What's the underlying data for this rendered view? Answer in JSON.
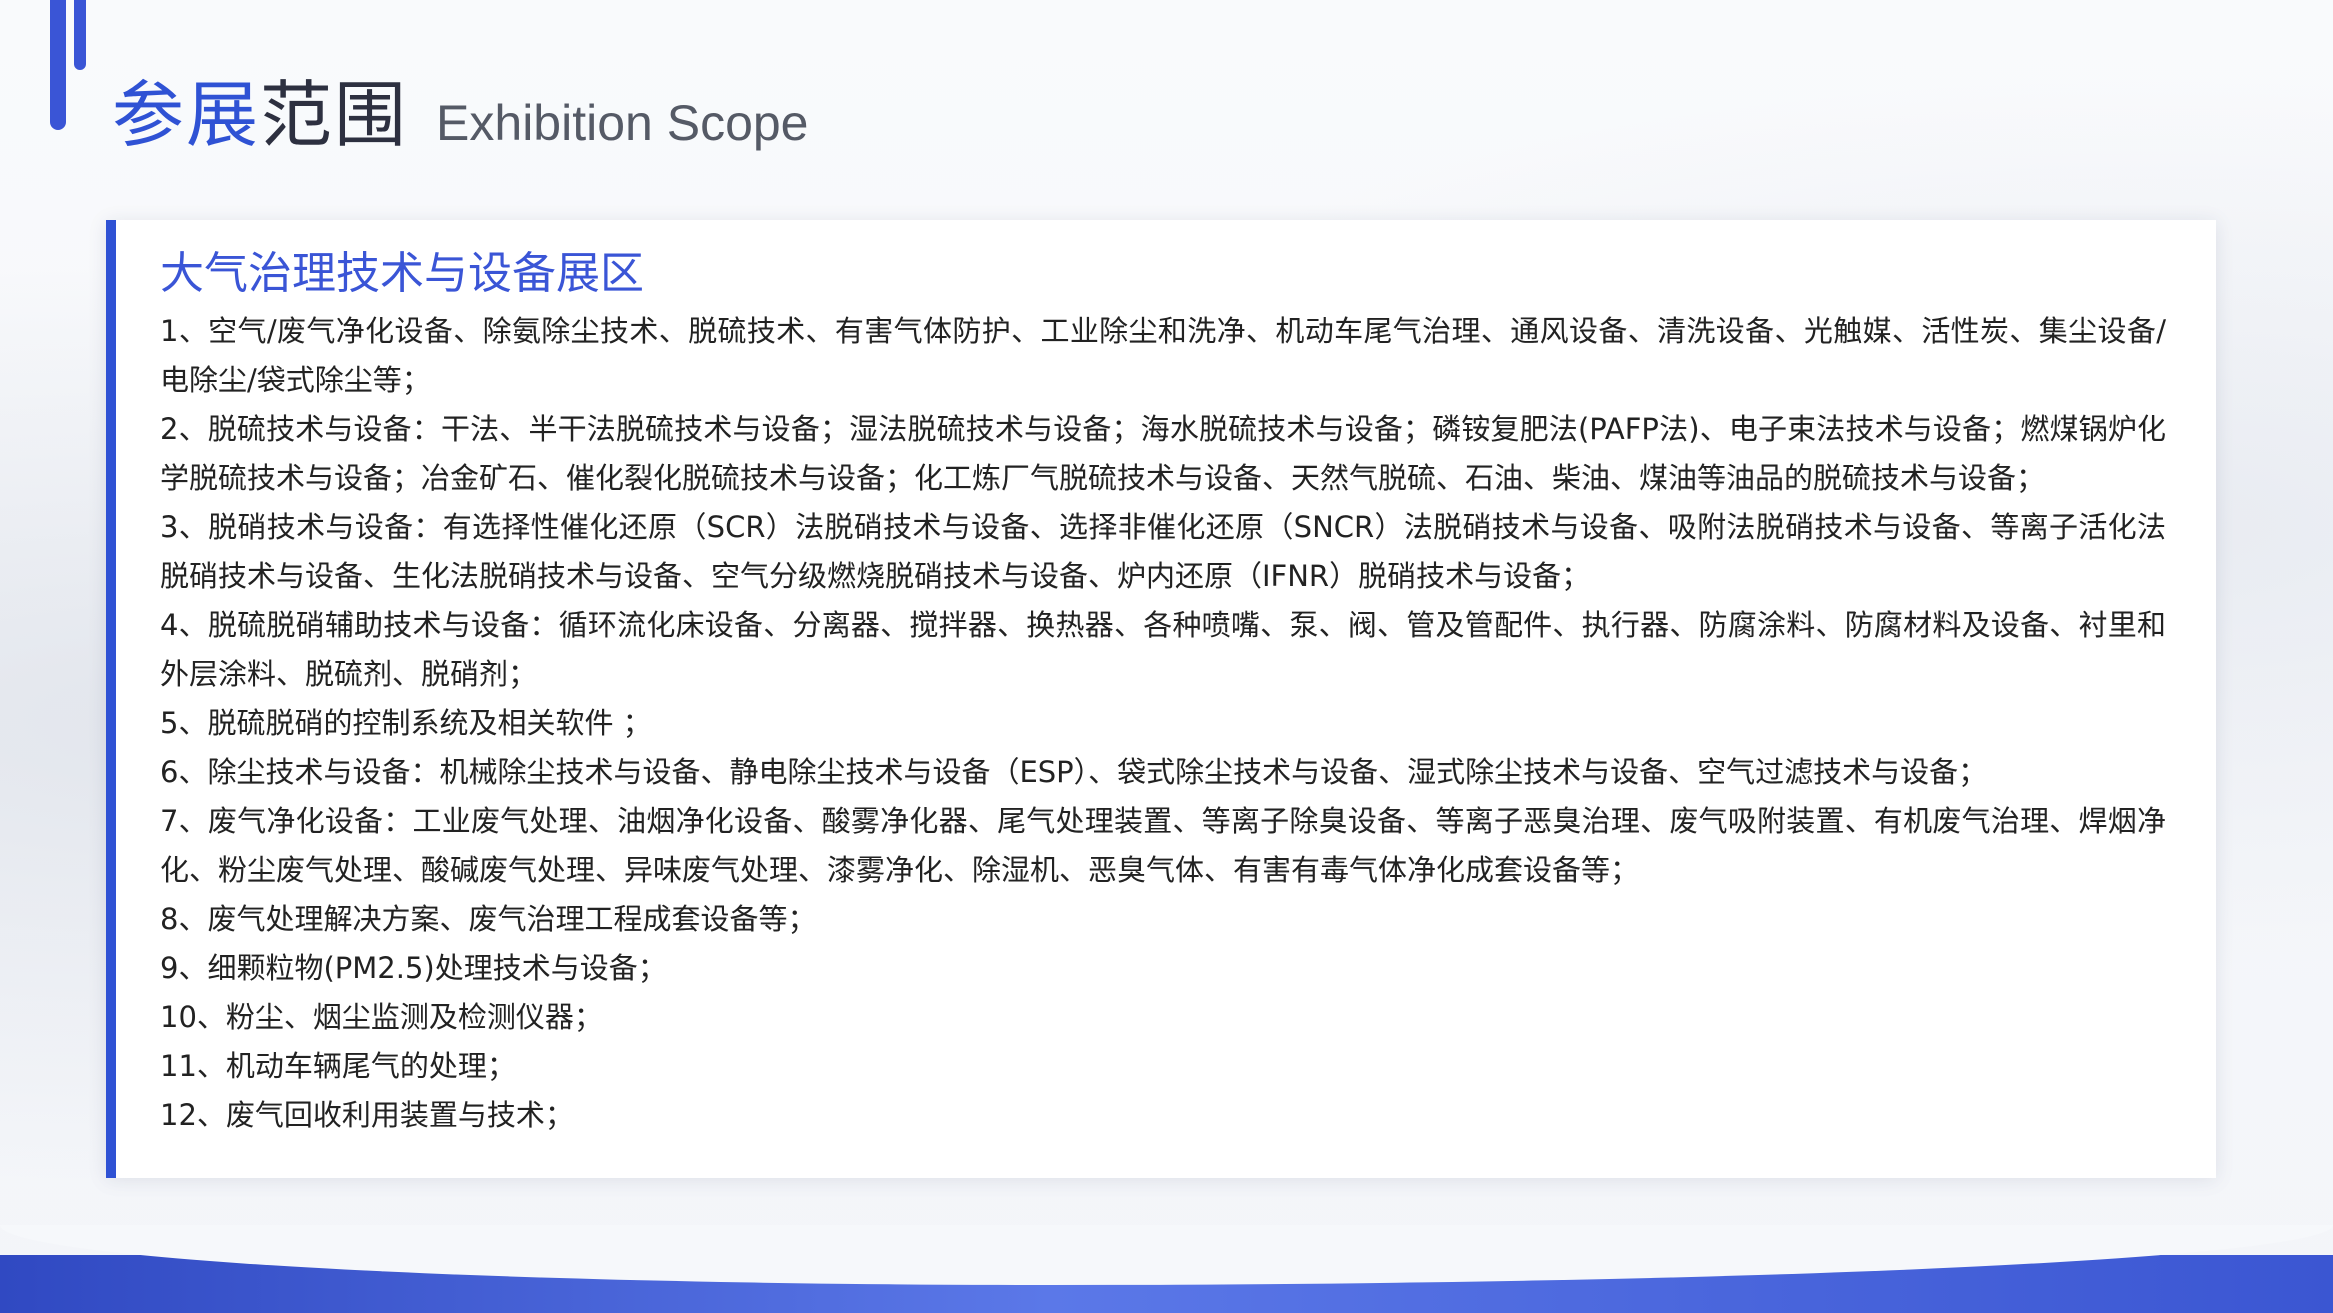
{
  "header": {
    "title_cn_part1": "参展",
    "title_cn_part2": "范围",
    "title_en": "Exhibition Scope"
  },
  "section": {
    "title": "大气治理技术与设备展区",
    "items": [
      "1、空气/废气净化设备、除氨除尘技术、脱硫技术、有害气体防护、工业除尘和洗净、机动车尾气治理、通风设备、清洗设备、光触媒、活性炭、集尘设备/电除尘/袋式除尘等；",
      "2、脱硫技术与设备：干法、半干法脱硫技术与设备；湿法脱硫技术与设备；海水脱硫技术与设备；磷铵复肥法(PAFP法)、电子束法技术与设备；燃煤锅炉化学脱硫技术与设备；冶金矿石、催化裂化脱硫技术与设备；化工炼厂气脱硫技术与设备、天然气脱硫、石油、柴油、煤油等油品的脱硫技术与设备；",
      "3、脱硝技术与设备：有选择性催化还原（SCR）法脱硝技术与设备、选择非催化还原（SNCR）法脱硝技术与设备、吸附法脱硝技术与设备、等离子活化法脱硝技术与设备、生化法脱硝技术与设备、空气分级燃烧脱硝技术与设备、炉内还原（IFNR）脱硝技术与设备；",
      "4、脱硫脱硝辅助技术与设备：循环流化床设备、分离器、搅拌器、换热器、各种喷嘴、泵、阀、管及管配件、执行器、防腐涂料、防腐材料及设备、衬里和外层涂料、脱硫剂、脱硝剂；",
      "5、脱硫脱硝的控制系统及相关软件 ；",
      "6、除尘技术与设备：机械除尘技术与设备、静电除尘技术与设备（ESP）、袋式除尘技术与设备、湿式除尘技术与设备、空气过滤技术与设备；",
      "7、废气净化设备：工业废气处理、油烟净化设备、酸雾净化器、尾气处理装置、等离子除臭设备、等离子恶臭治理、废气吸附装置、有机废气治理、焊烟净化、粉尘废气处理、酸碱废气处理、异味废气处理、漆雾净化、除湿机、恶臭气体、有害有毒气体净化成套设备等；",
      "8、废气处理解决方案、废气治理工程成套设备等；",
      "9、细颗粒物(PM2.5)处理技术与设备；",
      "10、粉尘、烟尘监测及检测仪器；",
      "11、机动车辆尾气的处理；",
      "12、废气回收利用装置与技术；"
    ]
  },
  "colors": {
    "accent": "#2f52d4",
    "title_dark": "#2d3040",
    "body_text": "#222222"
  }
}
